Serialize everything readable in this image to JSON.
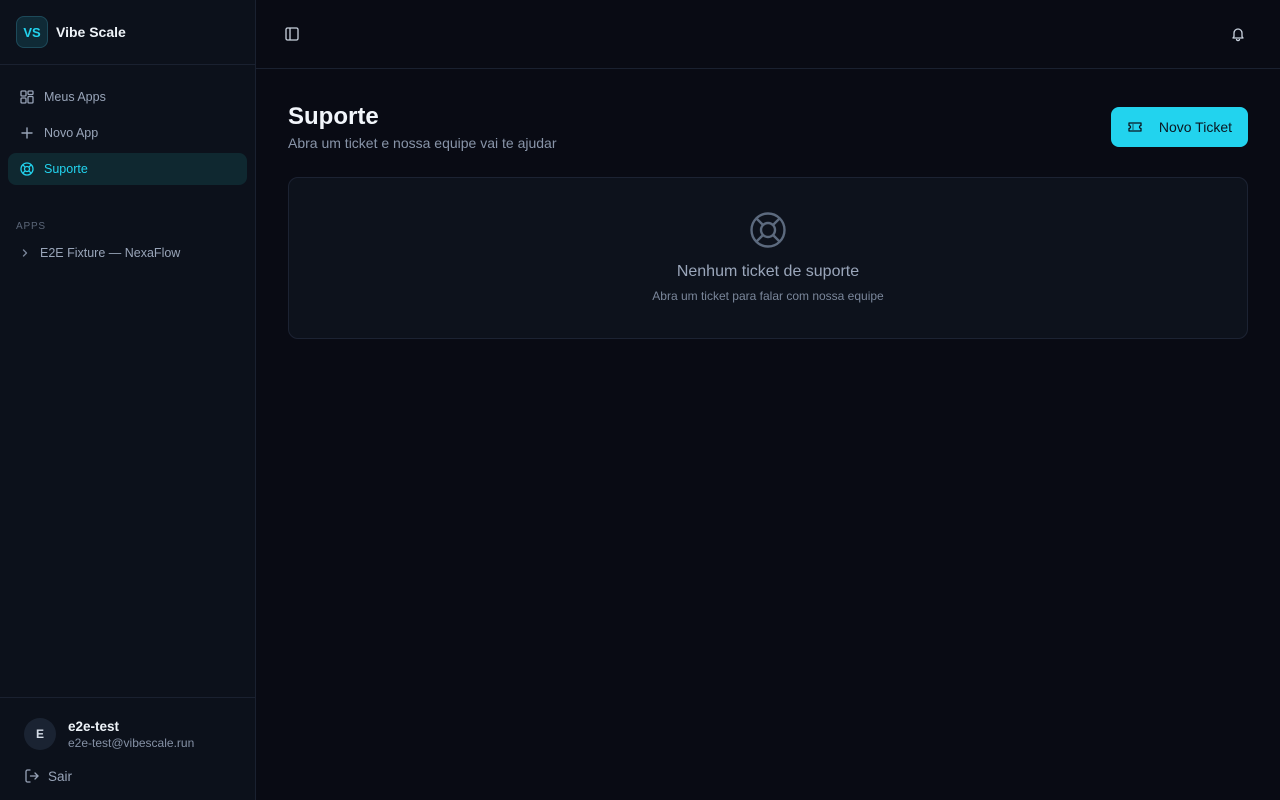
{
  "brand": {
    "logo_text": "VS",
    "name": "Vibe Scale"
  },
  "sidebar": {
    "nav": [
      {
        "label": "Meus Apps",
        "icon": "grid-icon"
      },
      {
        "label": "Novo App",
        "icon": "plus-icon"
      },
      {
        "label": "Suporte",
        "icon": "lifebuoy-icon",
        "active": true
      }
    ],
    "apps_section_label": "APPS",
    "apps": [
      {
        "label": "E2E Fixture — NexaFlow"
      }
    ]
  },
  "user": {
    "initial": "E",
    "name": "e2e-test",
    "email": "e2e-test@vibescale.run",
    "logout_label": "Sair"
  },
  "page": {
    "title": "Suporte",
    "subtitle": "Abra um ticket e nossa equipe vai te ajudar",
    "new_ticket_label": "Novo Ticket"
  },
  "empty_state": {
    "title": "Nenhum ticket de suporte",
    "subtitle": "Abra um ticket para falar com nossa equipe"
  },
  "colors": {
    "accent": "#22d3ee",
    "background": "#090b14",
    "sidebar_bg": "#0c111b"
  }
}
